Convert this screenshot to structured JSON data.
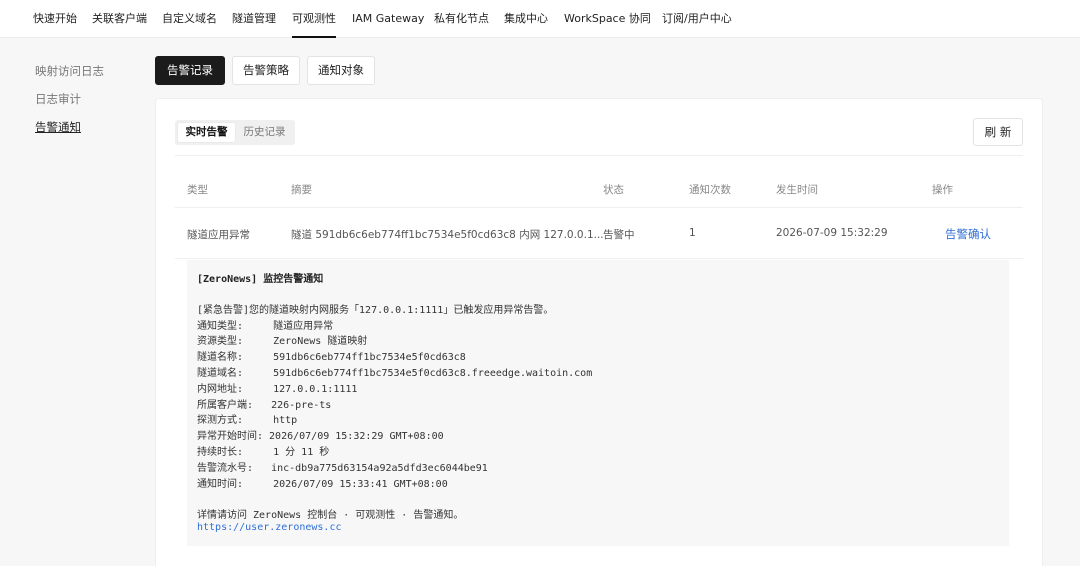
{
  "topnav": [
    {
      "label": "快速开始"
    },
    {
      "label": "关联客户端"
    },
    {
      "label": "自定义域名"
    },
    {
      "label": "隧道管理"
    },
    {
      "label": "可观测性"
    },
    {
      "label": "IAM Gateway"
    },
    {
      "label": "私有化节点"
    },
    {
      "label": "集成中心"
    },
    {
      "label": "WorkSpace 协同"
    },
    {
      "label": "订阅/用户中心"
    }
  ],
  "topnav_active": "可观测性",
  "sidebar": [
    {
      "label": "映射访问日志"
    },
    {
      "label": "日志审计"
    },
    {
      "label": "告警通知"
    }
  ],
  "sidebar_active": "告警通知",
  "tabs": [
    {
      "label": "告警记录"
    },
    {
      "label": "告警策略"
    },
    {
      "label": "通知对象"
    }
  ],
  "tabs_active": "告警记录",
  "segment": {
    "realtime": "实时告警",
    "history": "历史记录"
  },
  "refresh_label": "刷 新",
  "table": {
    "headers": [
      "类型",
      "摘要",
      "状态",
      "通知次数",
      "发生时间",
      "操作"
    ],
    "rows": [
      {
        "type": "隧道应用异常",
        "summary": "隧道 591db6c6eb774ff1bc7534e5f0cd63c8 内网 127.0.0.1...",
        "status": "告警中",
        "count": "1",
        "time": "2026-07-09 15:32:29",
        "action": "告警确认"
      }
    ]
  },
  "detail": {
    "title": "[ZeroNews] 监控告警通知",
    "intro": "[紧急告警]您的隧道映射内网服务「127.0.0.1:1111」已触发应用异常告警。",
    "fields": [
      "通知类型:     隧道应用异常",
      "资源类型:     ZeroNews 隧道映射",
      "隧道名称:     591db6c6eb774ff1bc7534e5f0cd63c8",
      "隧道域名:     591db6c6eb774ff1bc7534e5f0cd63c8.freeedge.waitoin.com",
      "内网地址:     127.0.0.1:1111",
      "所属客户端:   226-pre-ts",
      "探测方式:     http",
      "异常开始时间: 2026/07/09 15:32:29 GMT+08:00",
      "持续时长:     1 分 11 秒",
      "告警流水号:   inc-db9a775d63154a92a5dfd3ec6044be91",
      "通知时间:     2026/07/09 15:33:41 GMT+08:00"
    ],
    "footer": "详情请访问 ZeroNews 控制台 · 可观测性 · 告警通知。",
    "url": "https://user.zeronews.cc"
  }
}
